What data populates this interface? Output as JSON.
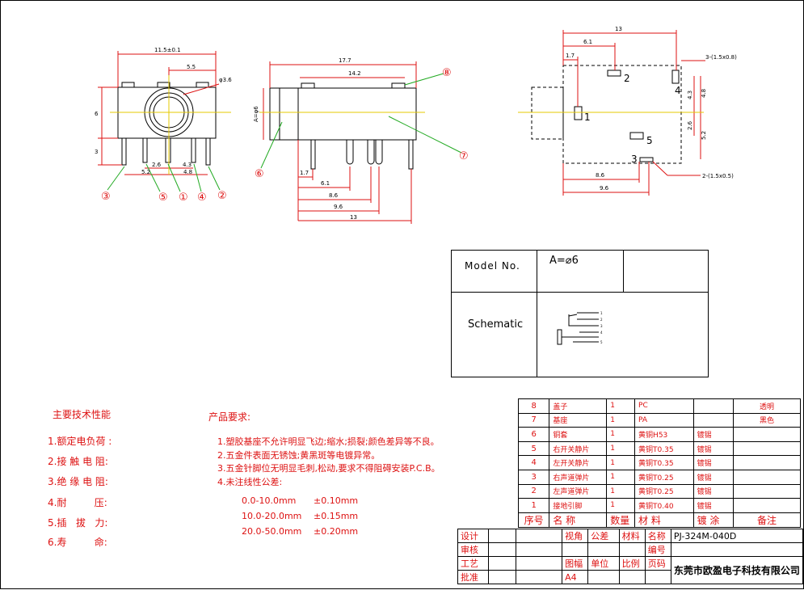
{
  "front_view": {
    "dims": {
      "width": "11.5±0.1",
      "top_offset": "5.5",
      "hole": "φ3.6",
      "height": "6",
      "pin_len": "3",
      "d_2_6": "2.6",
      "d_4_3": "4.3",
      "d_5_2": "5.2",
      "d_4_8": "4.8"
    },
    "callouts": [
      "③",
      "⑤",
      "①",
      "④",
      "②"
    ]
  },
  "side_view": {
    "dims": {
      "length": "17.7",
      "cover": "14.2",
      "dia": "A=φ6",
      "d_1_7": "1.7",
      "d_6_1": "6.1",
      "d_8_6": "8.6",
      "d_9_6": "9.6",
      "d_13": "13"
    },
    "callouts": [
      "⑧",
      "⑦",
      "⑥"
    ]
  },
  "footprint": {
    "dims": {
      "top": "13",
      "d_6_1": "6.1",
      "d_1_7": "1.7",
      "pad_size_3": "3-(1.5x0.8)",
      "pad_size_2": "2-(1.5x0.5)",
      "d_4_3": "4.3",
      "d_4_8": "4.8",
      "d_2_6": "2.6",
      "d_5_2": "5.2",
      "d_8_6": "8.6",
      "d_9_6": "9.6"
    },
    "pads": [
      "1",
      "2",
      "3",
      "4",
      "5"
    ]
  },
  "model_table": {
    "model_label": "Model No.",
    "model_value": "A=⌀6",
    "schematic_label": "Schematic",
    "schematic_pins": [
      "1",
      "2",
      "3",
      "4",
      "5"
    ]
  },
  "specs": {
    "title": "主要技术性能",
    "items": [
      "1.额定电负荷 :",
      "2.接 触 电 阻:",
      "3.绝 缘 电 阻:",
      "4.耐         压:",
      "5.插   拔   力:",
      "6.寿         命:"
    ]
  },
  "requirements": {
    "title": "产品要求:",
    "items": [
      "1.塑胶基座不允许明显飞边;缩水;损裂;颜色差异等不良。",
      "2.五金件表面无锈蚀;黄黑斑等电镀异常。",
      "3.五金针脚位无明显毛刺,松动,要求不得阻碍安装P.C.B。",
      "4.未注线性公差:"
    ],
    "tolerances": [
      {
        "range": "0.0-10.0mm",
        "tol": "±0.10mm"
      },
      {
        "range": "10.0-20.0mm",
        "tol": "±0.15mm"
      },
      {
        "range": "20.0-50.0mm",
        "tol": "±0.20mm"
      }
    ]
  },
  "bom": {
    "rows": [
      [
        "8",
        "盖子",
        "1",
        "PC",
        "",
        "透明"
      ],
      [
        "7",
        "基座",
        "1",
        "PA",
        "",
        "黑色"
      ],
      [
        "6",
        "铜套",
        "1",
        "黄铜H53",
        "镀锡",
        ""
      ],
      [
        "5",
        "右开关静片",
        "1",
        "黄铜T0.35",
        "镀锡",
        ""
      ],
      [
        "4",
        "左开关静片",
        "1",
        "黄铜T0.35",
        "镀锡",
        ""
      ],
      [
        "3",
        "右声道弹片",
        "1",
        "黄铜T0.25",
        "镀锡",
        ""
      ],
      [
        "2",
        "左声道弹片",
        "1",
        "黄铜T0.25",
        "镀锡",
        ""
      ],
      [
        "1",
        "接地引脚",
        "1",
        "黄铜T0.40",
        "镀锡",
        ""
      ]
    ],
    "header": [
      "序号",
      "名   称",
      "数量",
      "材   料",
      "镀   涂",
      "备注"
    ]
  },
  "title_block": {
    "r1": [
      "设计",
      "",
      "",
      "视角",
      "公差",
      "材料",
      "名称",
      "PJ-324M-040D"
    ],
    "r2": [
      "审核",
      "",
      "",
      "",
      "",
      "",
      "编号",
      ""
    ],
    "r3": [
      "工艺",
      "",
      "",
      "图幅",
      "单位",
      "比例",
      "页码"
    ],
    "r4": [
      "批准",
      "",
      "",
      "A4",
      "",
      "",
      ""
    ],
    "company": "东莞市欧盈电子科技有限公司"
  }
}
